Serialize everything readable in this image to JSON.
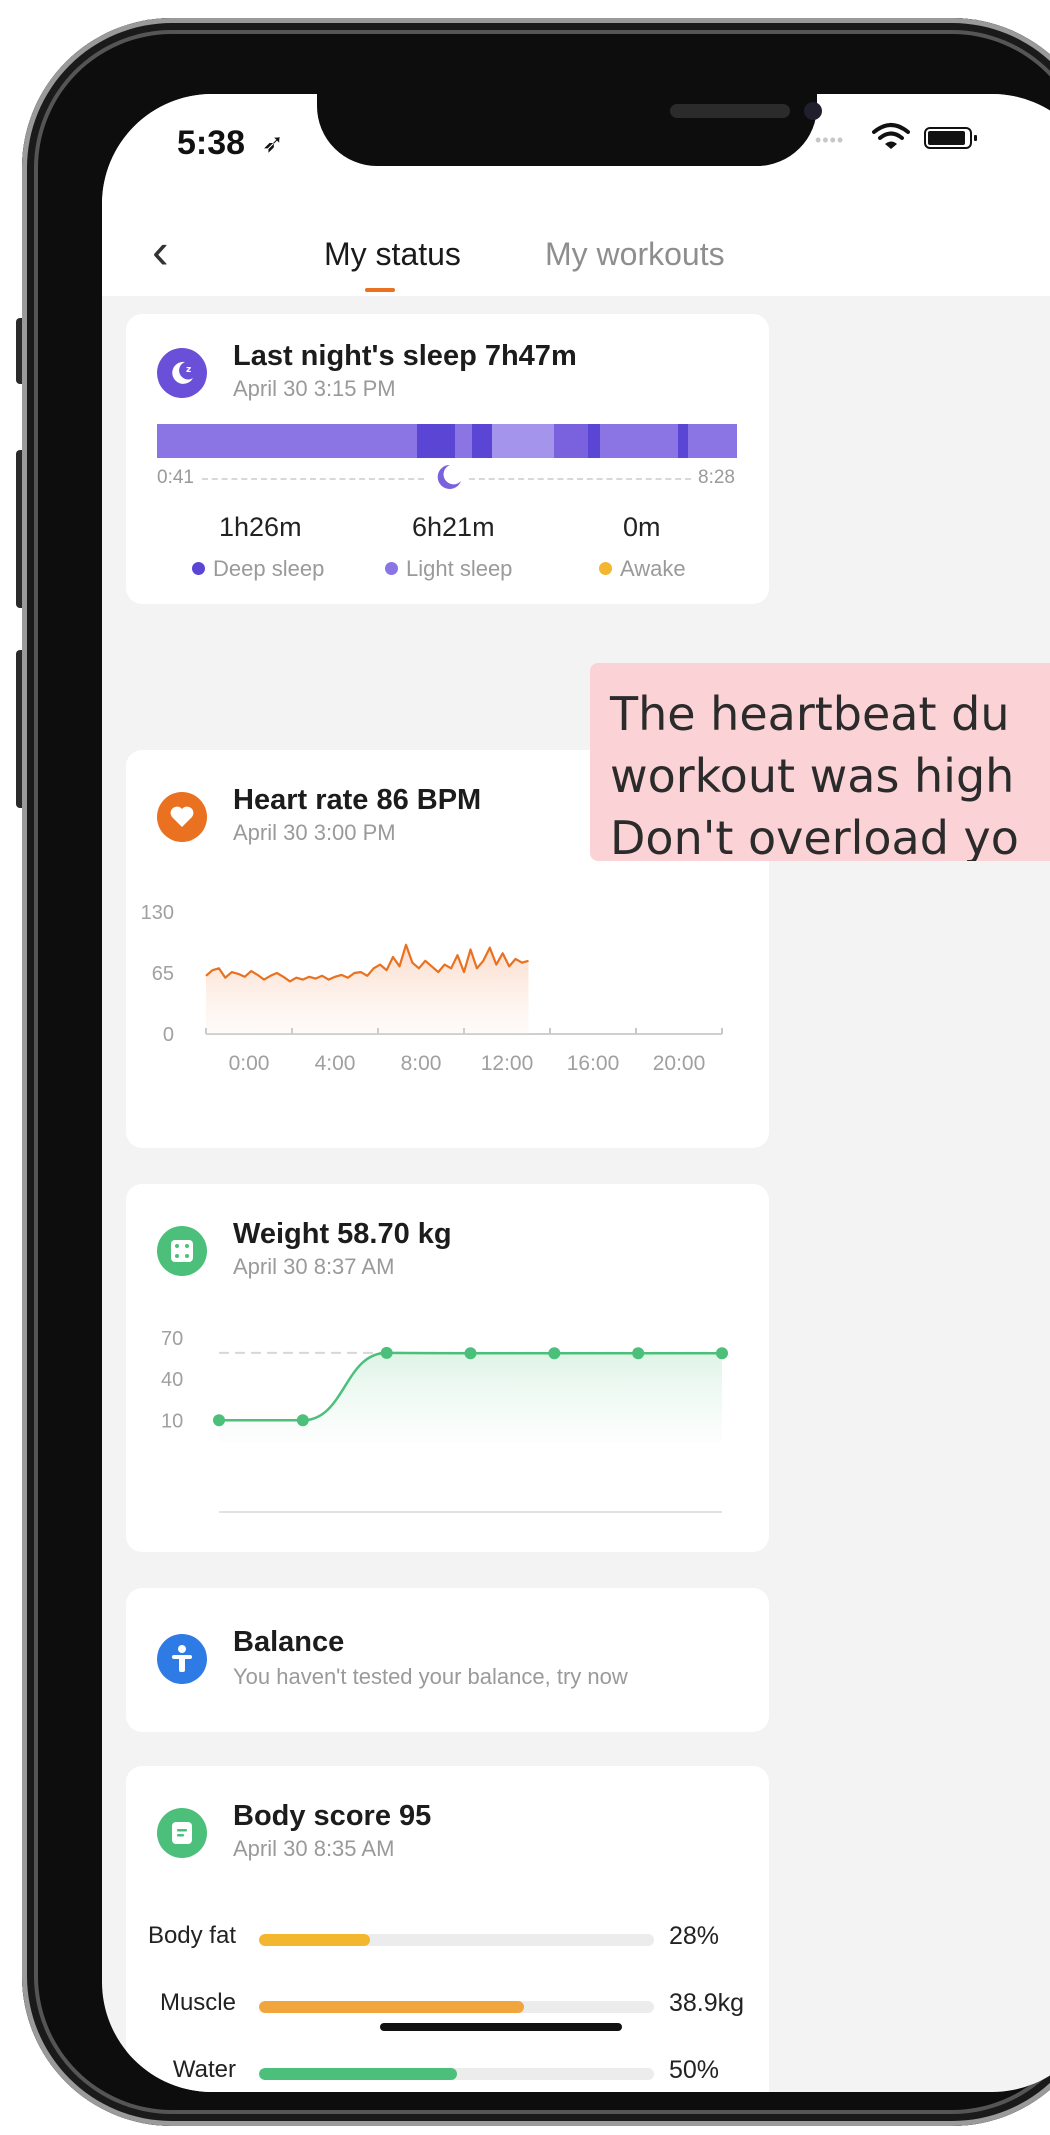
{
  "status_bar": {
    "time": "5:38",
    "location_icon": "location-arrow-icon",
    "wifi_icon": "wifi-icon",
    "battery_icon": "battery-icon"
  },
  "nav": {
    "back_icon": "back-chevron-icon",
    "tabs": [
      {
        "label": "My status",
        "active": true
      },
      {
        "label": "My workouts",
        "active": false
      }
    ],
    "accent_color": "#e9711f"
  },
  "sleep": {
    "icon": "sleep-moon-icon",
    "title": "Last night's sleep 7h47m",
    "date": "April 30 3:15 PM",
    "start_time": "0:41",
    "end_time": "8:28",
    "stats": [
      {
        "value": "1h26m",
        "label": "Deep sleep",
        "color": "#5b45d4"
      },
      {
        "value": "6h21m",
        "label": "Light sleep",
        "color": "#8b74e3"
      },
      {
        "value": "0m",
        "label": "Awake",
        "color": "#f2b62f"
      }
    ]
  },
  "heart": {
    "icon": "heart-icon",
    "title": "Heart rate 86  BPM",
    "date": "April 30 3:00 PM",
    "color": "#e9711f"
  },
  "weight": {
    "icon": "scale-icon",
    "title": "Weight 58.70 kg",
    "date": "April 30 8:37 AM",
    "color": "#4cbf7a"
  },
  "balance": {
    "icon": "balance-person-icon",
    "title": "Balance",
    "subtitle": "You haven't tested your balance, try now",
    "color": "#2f7be6"
  },
  "body_score": {
    "icon": "body-score-icon",
    "title": "Body score 95",
    "date": "April 30 8:35 AM",
    "rows": [
      {
        "label": "Body fat",
        "value": "28%",
        "fraction": 0.28,
        "color": "#f2b62f"
      },
      {
        "label": "Muscle",
        "value": "38.9kg",
        "fraction": 0.67,
        "color": "#f0a63d"
      },
      {
        "label": "Water",
        "value": "50%",
        "fraction": 0.5,
        "color": "#4cbf7a"
      }
    ]
  },
  "tooltip": {
    "lines": [
      "The heartbeat du",
      "workout was high",
      "Don't overload yo"
    ]
  },
  "chart_data": [
    {
      "type": "line",
      "title": "Heart rate 86  BPM",
      "xlabel": "",
      "ylabel": "",
      "ylim": [
        0,
        130
      ],
      "xlim": [
        0,
        24
      ],
      "y_ticks": [
        "130",
        "65",
        "0"
      ],
      "x_ticks": [
        "0:00",
        "4:00",
        "8:00",
        "12:00",
        "16:00",
        "20:00"
      ],
      "x_tick_values": [
        0,
        4,
        8,
        12,
        16,
        20
      ],
      "grid": false,
      "series": [
        {
          "x": [
            0,
            0.3,
            0.6,
            0.9,
            1.2,
            1.5,
            1.8,
            2.1,
            2.4,
            2.7,
            3.0,
            3.3,
            3.6,
            3.9,
            4.2,
            4.5,
            4.8,
            5.1,
            5.4,
            5.7,
            6.0,
            6.3,
            6.6,
            6.9,
            7.2,
            7.5,
            7.8,
            8.1,
            8.4,
            8.7,
            9.0,
            9.3,
            9.6,
            9.9,
            10.2,
            10.5,
            10.8,
            11.1,
            11.4,
            11.7,
            12.0,
            12.3,
            12.6,
            12.9,
            13.2,
            13.5,
            13.8,
            14.1,
            14.4,
            14.7,
            15.0
          ],
          "y": [
            62,
            68,
            70,
            60,
            66,
            64,
            61,
            67,
            63,
            58,
            62,
            65,
            61,
            56,
            60,
            58,
            61,
            59,
            62,
            58,
            61,
            63,
            60,
            65,
            66,
            62,
            70,
            74,
            68,
            82,
            72,
            95,
            76,
            70,
            78,
            72,
            66,
            74,
            70,
            84,
            66,
            90,
            70,
            78,
            92,
            74,
            86,
            72,
            80,
            76,
            78
          ]
        }
      ]
    },
    {
      "type": "line",
      "title": "Weight 58.70 kg",
      "xlabel": "",
      "ylabel": "",
      "ylim": [
        0,
        80
      ],
      "y_ticks": [
        "70",
        "40",
        "10"
      ],
      "grid": false,
      "series": [
        {
          "x": [
            0,
            1,
            2,
            3,
            4,
            5,
            6
          ],
          "y": [
            10,
            10,
            59,
            58.7,
            58.7,
            58.7,
            58.7
          ]
        }
      ]
    }
  ]
}
